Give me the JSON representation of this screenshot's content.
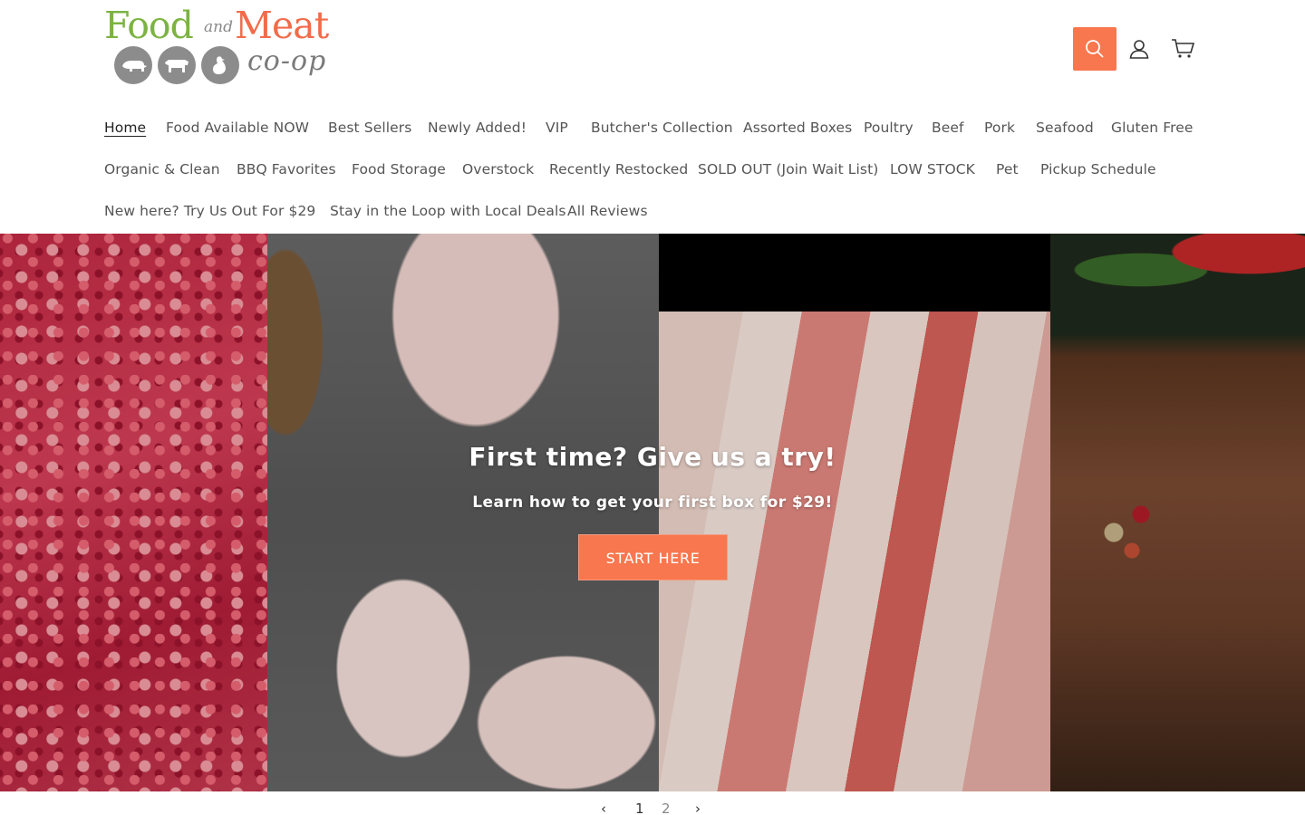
{
  "brand": {
    "logo_word_1": "Food",
    "logo_word_2": "and",
    "logo_word_3": "Meat",
    "logo_word_4": "co-op"
  },
  "header": {
    "icons": [
      "search-icon",
      "account-icon",
      "cart-icon"
    ],
    "search_color": "#f8774e"
  },
  "nav": {
    "row1": [
      "Home",
      "Food Available NOW",
      "Best Sellers",
      "Newly Added!",
      "VIP",
      "Butcher's Collection",
      "Assorted Boxes",
      "Poultry",
      "Beef",
      "Pork",
      "Seafood",
      "Gluten Free"
    ],
    "row2": [
      "Organic & Clean",
      "BBQ Favorites",
      "Food Storage",
      "Overstock",
      "Recently Restocked",
      "SOLD OUT (Join Wait List)",
      "LOW STOCK",
      "Pet",
      "Pickup Schedule"
    ],
    "row3": [
      "New here? Try Us Out For $29",
      "Stay in the Loop with Local Deals",
      "All Reviews"
    ],
    "active": "Home"
  },
  "hero": {
    "title": "First time? Give us a try!",
    "subtitle": "Learn how to get your first box for $29!",
    "button": "START HERE",
    "accent": "#f8774e"
  },
  "pager": {
    "prev": "‹",
    "page_1": "1",
    "page_2": "2",
    "next": "›"
  }
}
